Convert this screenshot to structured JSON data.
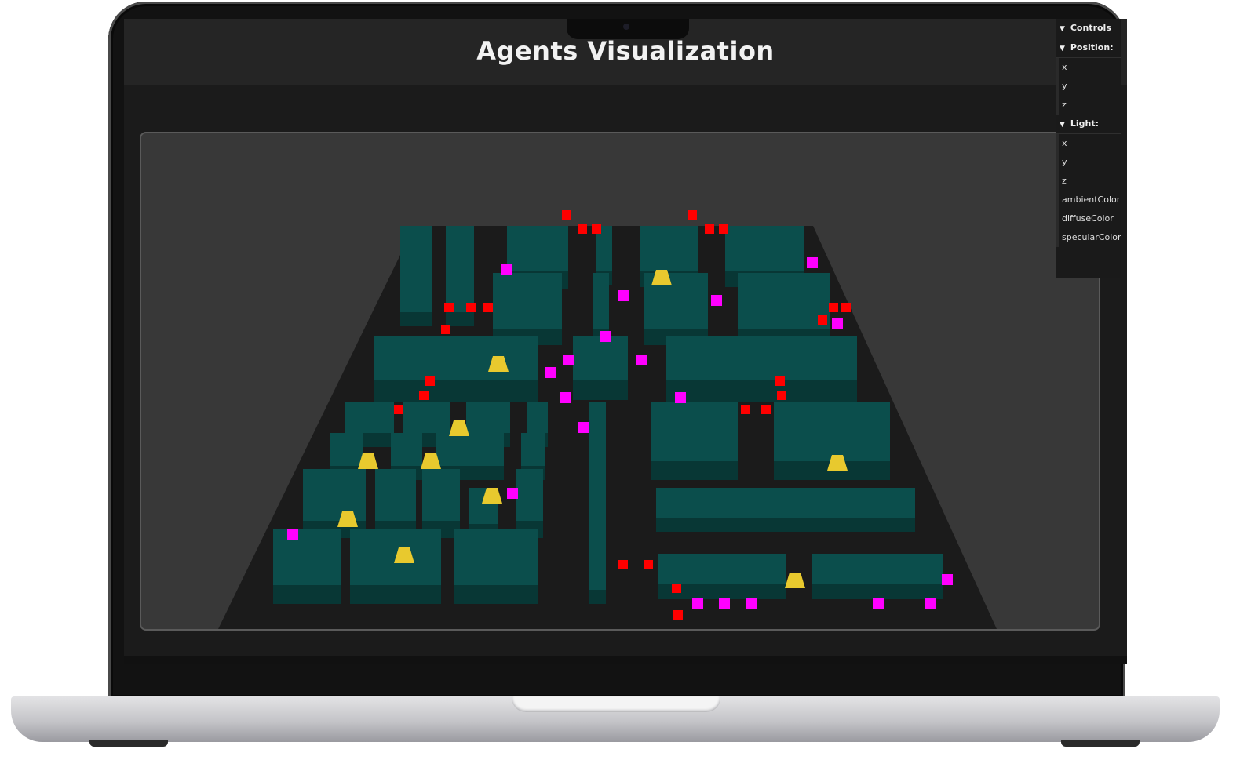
{
  "app": {
    "title": "Agents Visualization"
  },
  "controls": {
    "header": "Controls",
    "folders": [
      {
        "label": "Position:",
        "items": [
          "x",
          "y",
          "z"
        ]
      },
      {
        "label": "Light:",
        "items": [
          "x",
          "y",
          "z",
          "ambientColor",
          "diffuseColor",
          "specularColor"
        ]
      }
    ]
  },
  "scene": {
    "building_color": "#0b4e4c",
    "road_color": "#1b1b1b",
    "traffic_light_color": "#e8c92e",
    "agent_car_color": "#ff00ff",
    "obstacle_color": "#ff0000"
  }
}
